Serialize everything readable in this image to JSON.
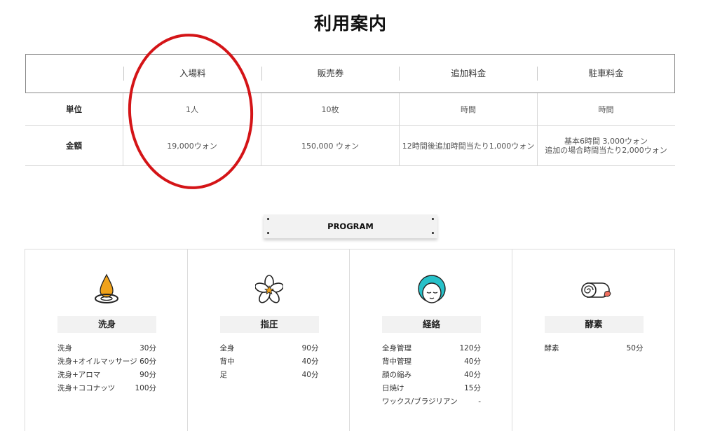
{
  "page": {
    "title": "利用案内"
  },
  "pricing": {
    "headers": [
      "",
      "入場料",
      "販売券",
      "追加料金",
      "駐車料金"
    ],
    "rows": [
      {
        "label": "単位",
        "cells": [
          "1人",
          "10枚",
          "時間",
          "時間"
        ]
      },
      {
        "label": "金額",
        "cells": [
          "19,000ウォン",
          "150,000 ウォン",
          "12時間後追加時間当たり1,000ウォン",
          "基本6時間 3,000ウォン",
          "追加の場合時間当たり2,000ウォン"
        ]
      }
    ]
  },
  "program": {
    "banner": "PROGRAM",
    "cards": [
      {
        "name": "洗身",
        "icon": "oil-drop-icon",
        "items": [
          {
            "label": "洗身",
            "value": "30分"
          },
          {
            "label": "洗身+オイルマッサージ",
            "value": "60分"
          },
          {
            "label": "洗身+アロマ",
            "value": "90分"
          },
          {
            "label": "洗身+ココナッツ",
            "value": "100分"
          }
        ]
      },
      {
        "name": "指圧",
        "icon": "flower-icon",
        "items": [
          {
            "label": "全身",
            "value": "90分"
          },
          {
            "label": "背中",
            "value": "40分"
          },
          {
            "label": "足",
            "value": "40分"
          }
        ]
      },
      {
        "name": "経絡",
        "icon": "face-towel-icon",
        "items": [
          {
            "label": "全身管理",
            "value": "120分"
          },
          {
            "label": "背中管理",
            "value": "40分"
          },
          {
            "label": "顔の縮み",
            "value": "40分"
          },
          {
            "label": "日焼け",
            "value": "15分"
          },
          {
            "label": "ワックス/ブラジリアン",
            "value": "-"
          }
        ]
      },
      {
        "name": "酵素",
        "icon": "rolled-towel-icon",
        "items": [
          {
            "label": "酵素",
            "value": "50分"
          }
        ]
      }
    ]
  },
  "colors": {
    "highlight_circle": "#d41417",
    "drop": "#f0a21b",
    "face": "#27c1c9",
    "leaf": "#f27060"
  }
}
